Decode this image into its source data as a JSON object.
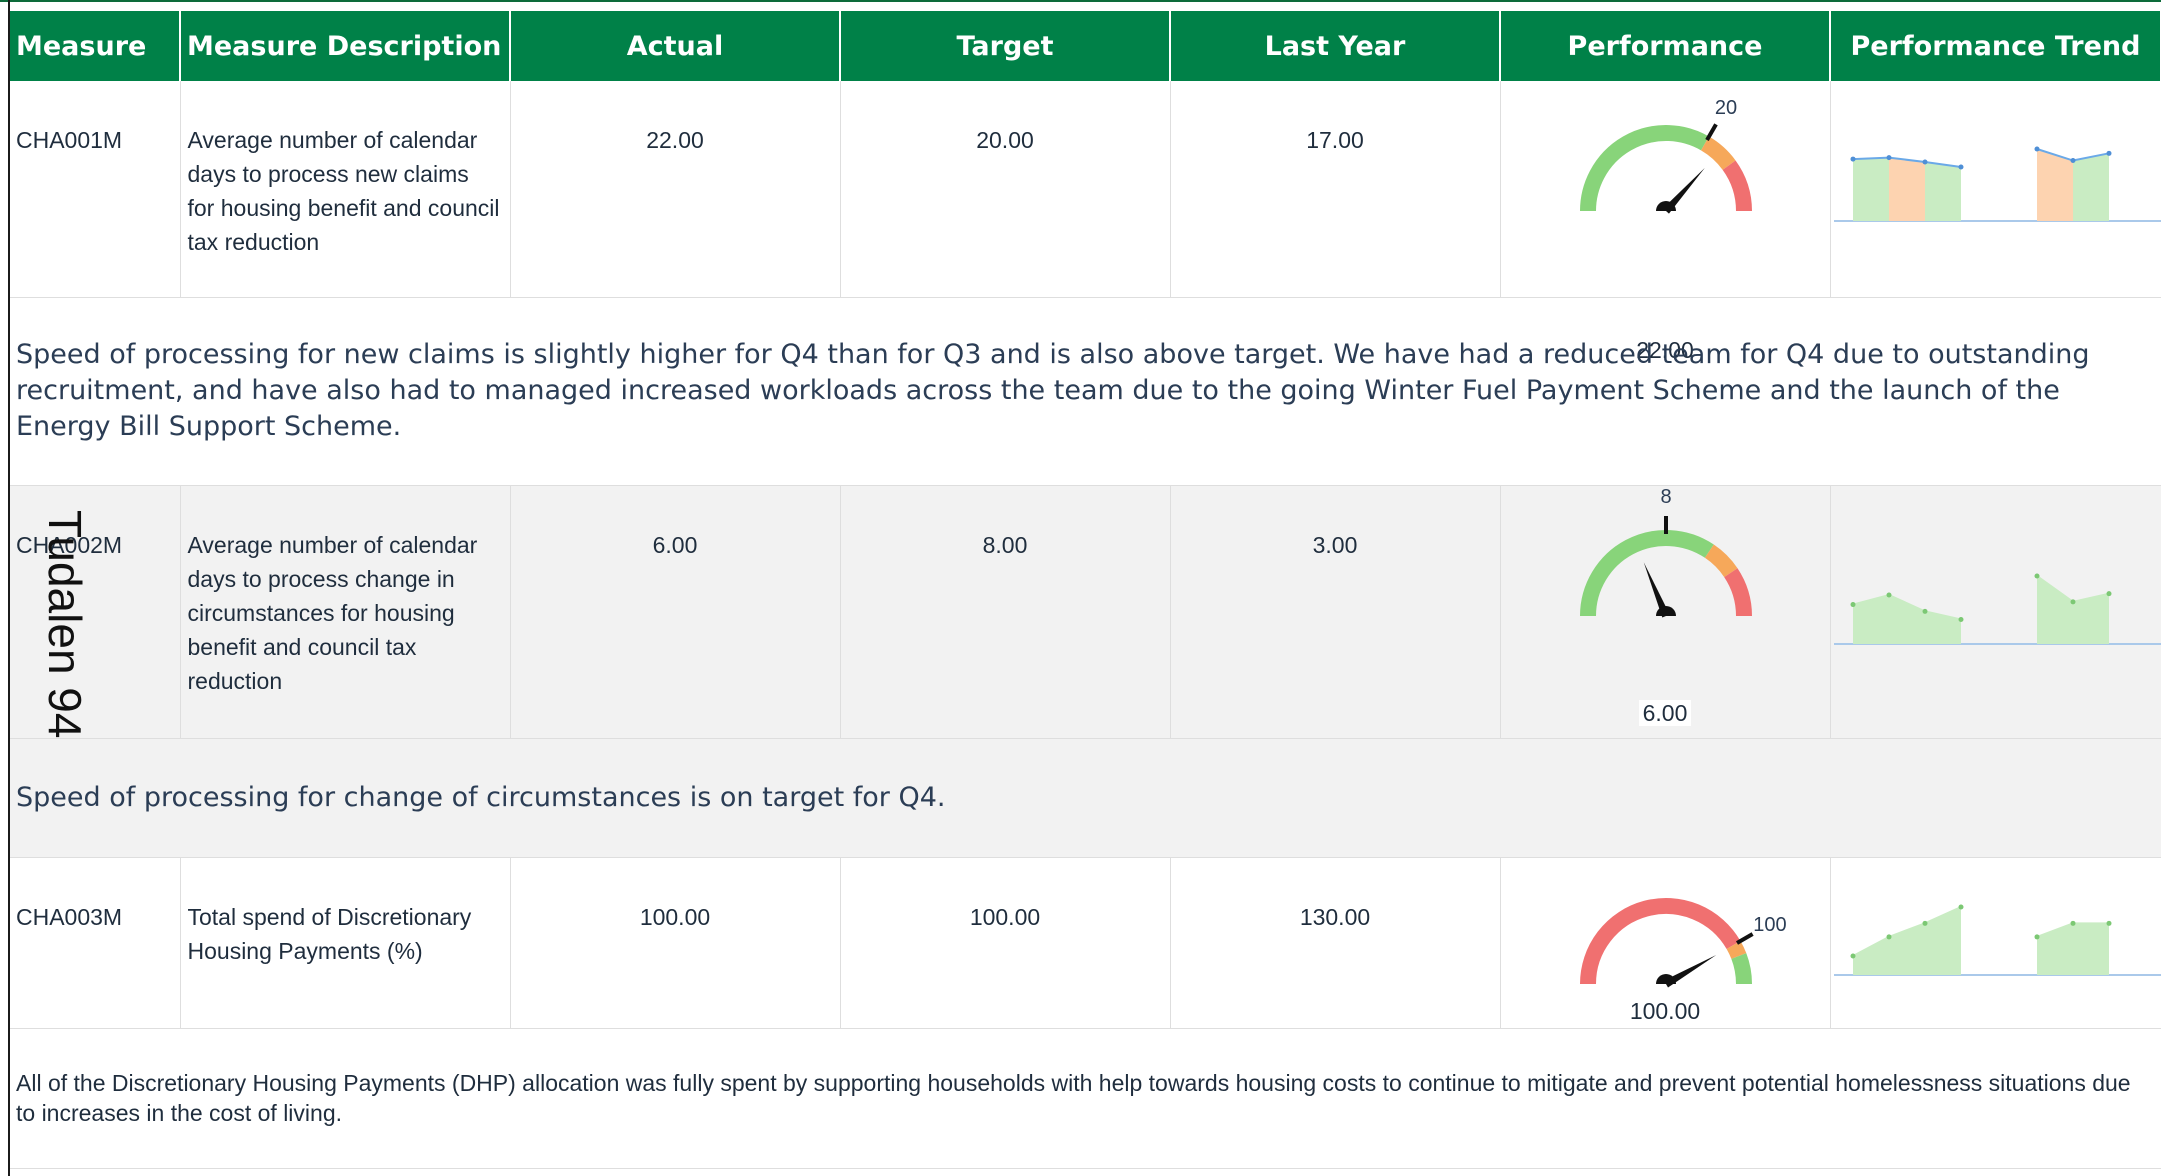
{
  "columns": [
    "Measure",
    "Measure Description",
    "Actual",
    "Target",
    "Last Year",
    "Performance",
    "Performance Trend"
  ],
  "colors": {
    "header_bg": "#008148",
    "header_text": "#ffffff",
    "gauge_green": "#88d47a",
    "gauge_amber": "#f6a85a",
    "gauge_red": "#f07070",
    "trend_green": "#c9ecc3",
    "trend_orange": "#fdd3b0",
    "trend_line_blue": "#6aa9e8",
    "row_shade": "#f2f2f2"
  },
  "rows": [
    {
      "measure": "CHA001M",
      "description": "Average number of calendar days to process new claims for housing benefit and council tax reduction",
      "actual": "22.00",
      "target": "20.00",
      "last_year": "17.00",
      "performance": {
        "value_label": "22.00",
        "target_label": "20",
        "value": 22,
        "target": 20,
        "min": 0,
        "max": 30,
        "bands": [
          {
            "to": 20,
            "color": "gauge_green"
          },
          {
            "to": 24,
            "color": "gauge_amber"
          },
          {
            "to": 30,
            "color": "gauge_red"
          }
        ]
      },
      "trend": {
        "groups": [
          [
            0.86,
            0.88,
            0.82,
            0.75
          ],
          [
            1.0,
            0.84,
            0.94
          ]
        ],
        "bar_colors": [
          [
            "trend_green",
            "trend_orange",
            "trend_green"
          ],
          [
            "trend_orange",
            "trend_green",
            "trend_orange"
          ]
        ],
        "line_color": "trend_line_blue"
      },
      "comment": "Speed of processing for new claims is slightly higher for Q4 than for Q3 and is also above target. We have had a reduced team for Q4 due to outstanding recruitment, and have also had to managed increased workloads across the team due to the going Winter Fuel Payment Scheme and the launch of the Energy Bill Support Scheme."
    },
    {
      "measure": "CHA002M",
      "description": "Average number of calendar days to process change in circumstances for housing benefit and council tax reduction",
      "actual": "6.00",
      "target": "8.00",
      "last_year": "3.00",
      "performance": {
        "value_label": "6.00",
        "target_label": "8",
        "value": 6,
        "target": 8,
        "min": 0,
        "max": 16,
        "bands": [
          {
            "to": 11,
            "color": "gauge_green"
          },
          {
            "to": 13,
            "color": "gauge_amber"
          },
          {
            "to": 16,
            "color": "gauge_red"
          }
        ]
      },
      "trend": {
        "groups": [
          [
            0.58,
            0.72,
            0.48,
            0.36
          ],
          [
            1.0,
            0.62,
            0.74
          ]
        ],
        "bar_colors": [
          [
            "trend_green",
            "trend_green",
            "trend_green"
          ],
          [
            "trend_green",
            "trend_green",
            "trend_green"
          ]
        ],
        "line_color": "trend_green"
      },
      "comment": "Speed of processing for change of circumstances is on target for Q4."
    },
    {
      "measure": "CHA003M",
      "description": "Total spend of Discretionary Housing Payments (%)",
      "actual": "100.00",
      "target": "100.00",
      "last_year": "130.00",
      "performance": {
        "value_label": "100.00",
        "target_label": "100",
        "value": 100,
        "target": 100,
        "min": 0,
        "max": 120,
        "bands": [
          {
            "to": 100,
            "color": "gauge_red"
          },
          {
            "to": 106,
            "color": "gauge_amber"
          },
          {
            "to": 120,
            "color": "gauge_green"
          }
        ]
      },
      "trend": {
        "groups": [
          [
            0.28,
            0.56,
            0.76,
            1.0
          ],
          [
            0.56,
            0.76,
            0.76
          ]
        ],
        "bar_colors": [
          [
            "trend_green",
            "trend_green",
            "trend_green"
          ],
          [
            "trend_green",
            "trend_green"
          ]
        ],
        "line_color": "trend_green"
      },
      "comment": "All of the Discretionary Housing Payments (DHP) allocation was fully spent by supporting households with help towards housing costs to continue to mitigate and prevent potential homelessness situations due to increases in the cost of living."
    }
  ],
  "watermark": "Tudalen 94"
}
